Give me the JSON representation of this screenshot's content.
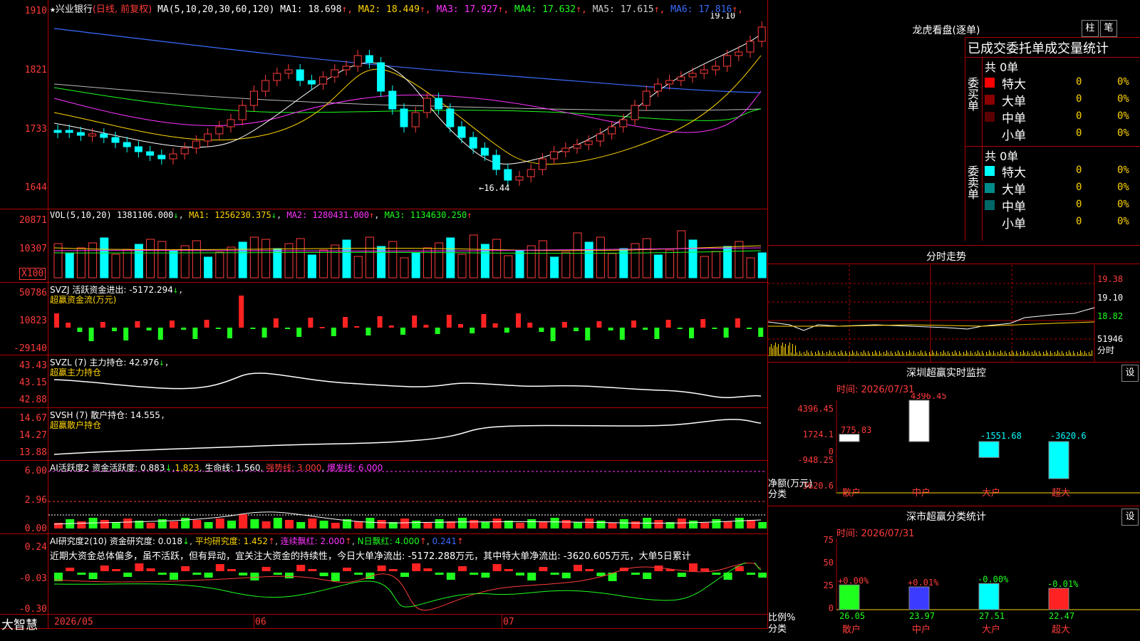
{
  "stock": {
    "name": "兴业银行",
    "mode": "(日线, 前复权)",
    "ma_label": "MA(5,10,20,30,60,120)",
    "ma": [
      {
        "label": "MA1:",
        "value": "18.698",
        "color": "#ffffff"
      },
      {
        "label": "MA2:",
        "value": "18.449",
        "color": "#ffd400"
      },
      {
        "label": "MA3:",
        "value": "17.927",
        "color": "#ff33ff"
      },
      {
        "label": "MA4:",
        "value": "17.632",
        "color": "#1eff1e"
      },
      {
        "label": "MA5:",
        "value": "17.615",
        "color": "#cccccc"
      },
      {
        "label": "MA6:",
        "value": "17.816",
        "color": "#3b6bff"
      }
    ],
    "high_label": "19.10",
    "low_label": "←16.44",
    "axis": [
      "1910",
      "1821",
      "1733",
      "1644"
    ]
  },
  "vol": {
    "label": "VOL(5,10,20)",
    "value": "1381106.000",
    "ma1": "MA1: 1256230.375",
    "ma2": "MA2: 1280431.000",
    "ma3": "MA3: 1134630.250",
    "axis": [
      "20871",
      "10307"
    ],
    "unit": "X100"
  },
  "svzj": {
    "label": "SVZJ  活跃资金进出: -5172.294",
    "sub": "超赢资金流(万元)",
    "axis": [
      "50786",
      "10823",
      "-29140"
    ]
  },
  "svzl": {
    "label": "SVZL (7) 主力持仓: 42.976",
    "sub": "超赢主力持仓",
    "axis": [
      "43.43",
      "43.15",
      "42.88"
    ]
  },
  "svsh": {
    "label": "SVSH (7) 散户持仓: 14.555",
    "sub": "超赢散户持仓",
    "axis": [
      "14.67",
      "14.27",
      "13.88"
    ]
  },
  "ai1": {
    "label": "AI活跃度2 资金活跃度: 0.883",
    "v2": "1.823",
    "life": "生命线: 1.560",
    "strong": "强势线: 3.000",
    "burst": "爆发线: 6.000",
    "axis": [
      "6.00",
      "2.96",
      "0.00"
    ]
  },
  "ai2": {
    "label": "AI研究度2(10) 资金研究度: 0.018",
    "avg": "平均研究度: 1.452",
    "cont": "连续飘红: 2.000",
    "nday": "N日飘红: 4.000",
    "last": "0.241",
    "text": "近期大资金总体偏多，虽不活跃，但有异动，宜关注大资金的持续性，今日大单净流出: -5172.288万元，其中特大单净流出: -3620.605万元，大单5日累计",
    "axis": [
      "0.24",
      "-0.03",
      "-0.30"
    ]
  },
  "footer": {
    "brand": "大智慧",
    "dates": [
      "2026/05",
      "06",
      "07"
    ]
  },
  "right": {
    "lhb_title": "龙虎看盘(逐单)",
    "btn_zhu": "柱",
    "btn_bi": "笔",
    "stat_title": "已成交委托单成交量统计",
    "buy_side": "委买单",
    "sell_side": "委卖单",
    "buy_total": "共 0单",
    "sell_total": "共 0单",
    "buy_rows": [
      {
        "name": "特大",
        "n": "0",
        "p": "0%",
        "color": "#ff0000"
      },
      {
        "name": "大单",
        "n": "0",
        "p": "0%",
        "color": "#8b0000"
      },
      {
        "name": "中单",
        "n": "0",
        "p": "0%",
        "color": "#5a0000"
      },
      {
        "name": "小单",
        "n": "0",
        "p": "0%",
        "color": ""
      }
    ],
    "sell_rows": [
      {
        "name": "特大",
        "n": "0",
        "p": "0%",
        "color": "#00ffff"
      },
      {
        "name": "大单",
        "n": "0",
        "p": "0%",
        "color": "#008b8b"
      },
      {
        "name": "中单",
        "n": "0",
        "p": "0%",
        "color": "#006666"
      },
      {
        "name": "小单",
        "n": "0",
        "p": "0%",
        "color": ""
      }
    ],
    "intraday_title": "分时走势",
    "intraday_axis": [
      "19.38",
      "19.10",
      "18.82"
    ],
    "intraday_vol": "51946",
    "intraday_unit": "分时",
    "monitor_title": "深圳超赢实时监控",
    "monitor_btn": "设",
    "monitor_time": "时间: 2026/07/31",
    "monitor_axis": [
      "4396.45",
      "1724.1",
      "0",
      "-948.25",
      "-3620.6"
    ],
    "monitor_ylabel": "净额(万元)",
    "monitor_xlabel": "分类",
    "stats_title": "深市超赢分类统计",
    "stats_btn": "设",
    "stats_time": "时间: 2026/07/31",
    "stats_axis": [
      "75",
      "50",
      "25",
      "0"
    ],
    "stats_ylabel": "比例%",
    "stats_xlabel": "分类"
  },
  "chart_data": [
    {
      "type": "bar",
      "title": "深圳超赢实时监控",
      "categories": [
        "散户",
        "中户",
        "大户",
        "超大"
      ],
      "values": [
        775.83,
        4396.45,
        -1551.68,
        -3620.6
      ],
      "ylabel": "净额(万元)",
      "xlabel": "分类",
      "ylim": [
        -3620.6,
        4396.45
      ],
      "colors": [
        "#ffffff",
        "#ffffff",
        "#00ffff",
        "#00ffff"
      ]
    },
    {
      "type": "bar",
      "title": "深市超赢分类统计",
      "categories": [
        "散户",
        "中户",
        "大户",
        "超大"
      ],
      "values": [
        26.05,
        23.97,
        27.51,
        22.47
      ],
      "changes": [
        "+0.00%",
        "+0.01%",
        "-0.00%",
        "-0.01%"
      ],
      "ylabel": "比例%",
      "xlabel": "分类",
      "ylim": [
        0,
        75
      ],
      "colors": [
        "#1eff1e",
        "#3b3bff",
        "#00ffff",
        "#ff2222"
      ]
    }
  ]
}
